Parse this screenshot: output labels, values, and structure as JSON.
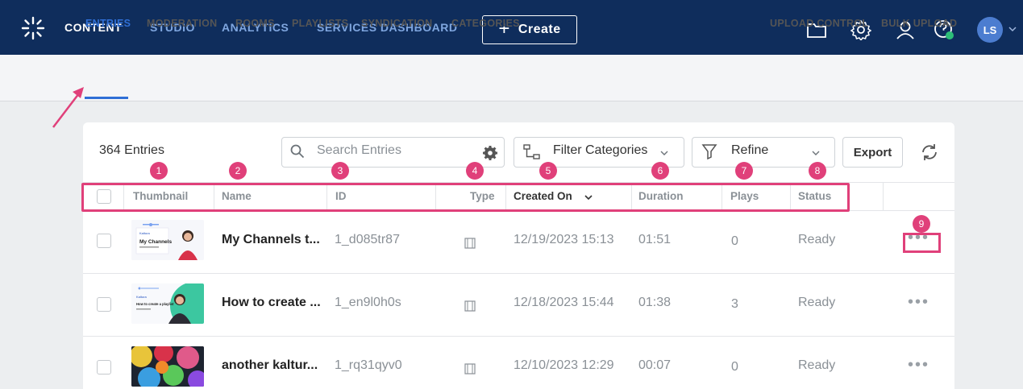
{
  "topbar": {
    "nav": [
      "CONTENT",
      "STUDIO",
      "ANALYTICS",
      "SERVICES DASHBOARD"
    ],
    "create_label": "Create",
    "avatar_initials": "LS",
    "icons": [
      "folder-icon",
      "settings-icon",
      "user-icon",
      "help-icon"
    ]
  },
  "subnav": {
    "left": [
      "ENTRIES",
      "MODERATION",
      "ROOMS",
      "PLAYLISTS",
      "SYNDICATION",
      "CATEGORIES"
    ],
    "right": [
      "UPLOAD CONTROL",
      "BULK UPLOAD"
    ],
    "active": "ENTRIES"
  },
  "toolbar": {
    "entries_count": "364 Entries",
    "search_placeholder": "Search Entries",
    "filter_categories": "Filter Categories",
    "refine": "Refine",
    "export": "Export"
  },
  "table": {
    "columns": [
      "Thumbnail",
      "Name",
      "ID",
      "Type",
      "Created On",
      "Duration",
      "Plays",
      "Status"
    ],
    "sort_column": "Created On",
    "rows": [
      {
        "name": "My Channels t...",
        "id": "1_d085tr87",
        "created": "12/19/2023 15:13",
        "duration": "01:51",
        "plays": "0",
        "status": "Ready"
      },
      {
        "name": "How to create ...",
        "id": "1_en9l0h0s",
        "created": "12/18/2023 15:44",
        "duration": "01:38",
        "plays": "3",
        "status": "Ready"
      },
      {
        "name": "another kaltur...",
        "id": "1_rq31qyv0",
        "created": "12/10/2023 12:29",
        "duration": "00:07",
        "plays": "0",
        "status": "Ready"
      }
    ],
    "thumb_texts": {
      "brand": "Kaltura",
      "t1_title": "My Channels",
      "t2_title": "How to create a playlist"
    }
  },
  "annotations": {
    "badges": [
      "1",
      "2",
      "3",
      "4",
      "5",
      "6",
      "7",
      "8",
      "9"
    ],
    "color": "#e0407a"
  },
  "colors": {
    "topbar": "#0f2d5c",
    "accent": "#2f6fd6",
    "highlight": "#e0407a"
  }
}
